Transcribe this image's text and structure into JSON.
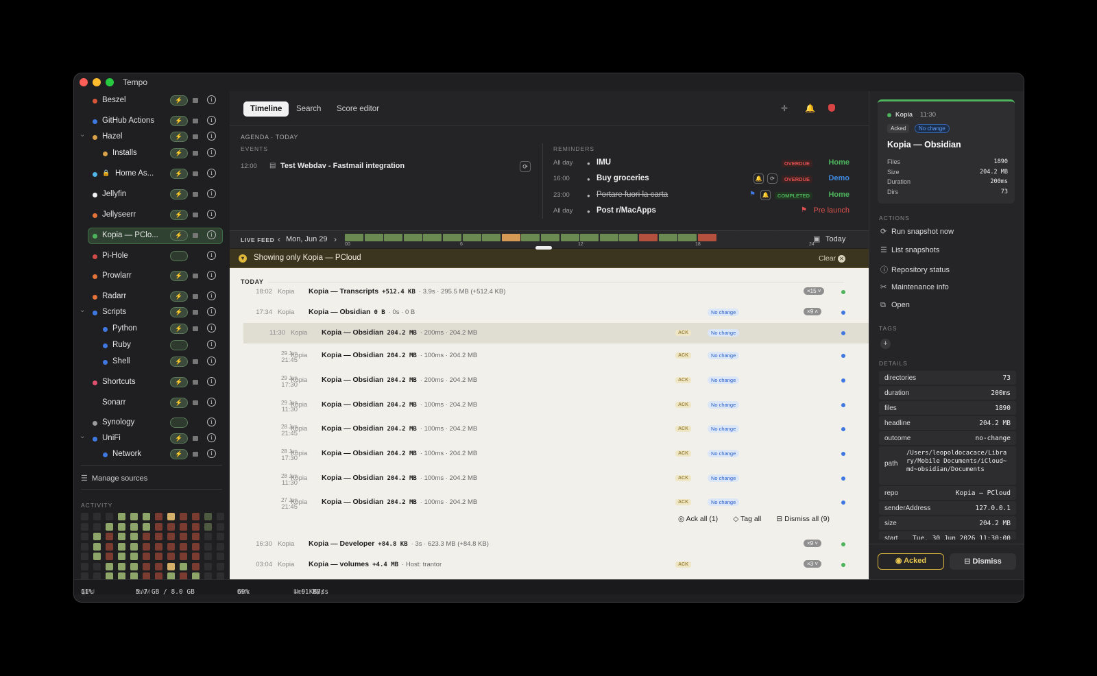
{
  "app": {
    "title": "Tempo"
  },
  "sidebar": {
    "sources": [
      {
        "name": "Beszel",
        "color": "#d5563b"
      },
      {
        "name": "GitHub Actions",
        "color": "#3f78e0"
      },
      {
        "name": "Hazel",
        "color": "#d9a14a"
      },
      {
        "name": "Installs",
        "color": "#d9a14a"
      },
      {
        "name": "Home As...",
        "color": "#4fb4e6"
      },
      {
        "name": "Jellyfin",
        "color": "#f2f2f2"
      },
      {
        "name": "Jellyseerr",
        "color": "#e4733a"
      },
      {
        "name": "Kopia — PClo...",
        "color": "#4db35c"
      },
      {
        "name": "Pi-Hole",
        "color": "#d14a4a"
      },
      {
        "name": "Prowlarr",
        "color": "#e4733a"
      },
      {
        "name": "Radarr",
        "color": "#e4733a"
      },
      {
        "name": "Scripts",
        "color": "#3f78e0"
      },
      {
        "name": "Python",
        "color": "#3f78e0"
      },
      {
        "name": "Ruby",
        "color": "#3f78e0"
      },
      {
        "name": "Shell",
        "color": "#3f78e0"
      },
      {
        "name": "Shortcuts",
        "color": "#e0506f"
      },
      {
        "name": "Sonarr",
        "color": "#3fbfd6"
      },
      {
        "name": "Synology",
        "color": "#9a9a9a"
      },
      {
        "name": "UniFi",
        "color": "#3f78e0"
      },
      {
        "name": "Network",
        "color": "#3f78e0"
      }
    ],
    "pill_glyph": "⚡",
    "manage_label": "Manage sources",
    "activity_label": "ACTIVITY"
  },
  "status": {
    "cpu_label": "CPU",
    "cpu": "11%",
    "ram_label": "RAM",
    "ram": "5.7 GB / 8.0 GB",
    "disk_label": "Disk",
    "disk": "69%",
    "net_label": "Net",
    "net_down": "↓ 9 KB/s",
    "net_up": "↑ 1 KB/s"
  },
  "toolbar": {
    "tabs": [
      "Timeline",
      "Search",
      "Score editor"
    ]
  },
  "agenda": {
    "heading": "AGENDA · TODAY",
    "events_label": "EVENTS",
    "reminders_label": "REMINDERS",
    "event": {
      "time": "12:00",
      "title": "Test Webdav - Fastmail integration"
    },
    "reminders": [
      {
        "time": "All day",
        "name": "IMU",
        "badge": "OVERDUE",
        "tag": "Home"
      },
      {
        "time": "16:00",
        "name": "Buy groceries",
        "badge": "OVERDUE",
        "tag": "Demo"
      },
      {
        "time": "23:00",
        "name": "Portare fuori la carta",
        "badge": "COMPLETED",
        "tag": "Home"
      },
      {
        "time": "All day",
        "name": "Post r/MacApps",
        "badge": "",
        "tag": "Pre launch"
      }
    ]
  },
  "livefeed": {
    "label": "LIVE FEED",
    "date": "Mon, Jun 29",
    "today": "Today",
    "ticks": [
      "00",
      "6",
      "12",
      "18",
      "24"
    ]
  },
  "filter": {
    "text": "Showing only Kopia — PCloud",
    "clear": "Clear"
  },
  "feed": {
    "section": "TODAY",
    "rows": [
      {
        "time": "18:02",
        "source": "Kopia",
        "title": "Kopia — Transcripts",
        "size": "+512.4 KB",
        "detail": "· 3.9s · 295.5 MB (+512.4 KB)",
        "count": "×15"
      },
      {
        "time": "17:34",
        "source": "Kopia",
        "title": "Kopia — Obsidian",
        "size": "0 B",
        "detail": "· 0s · 0 B",
        "nochange": "No change",
        "count": "×9"
      }
    ],
    "subrows": [
      {
        "date": "",
        "time": "11:30",
        "source": "Kopia",
        "title": "Kopia — Obsidian",
        "size": "204.2 MB",
        "detail": "· 200ms · 204.2 MB",
        "ack": "ACK",
        "nochange": "No change"
      },
      {
        "date": "29 Jun",
        "time": "21:45",
        "source": "Kopia",
        "title": "Kopia — Obsidian",
        "size": "204.2 MB",
        "detail": "· 100ms · 204.2 MB",
        "ack": "ACK",
        "nochange": "No change"
      },
      {
        "date": "29 Jun",
        "time": "17:30",
        "source": "Kopia",
        "title": "Kopia — Obsidian",
        "size": "204.2 MB",
        "detail": "· 200ms · 204.2 MB",
        "ack": "ACK",
        "nochange": "No change"
      },
      {
        "date": "29 Jun",
        "time": "11:30",
        "source": "Kopia",
        "title": "Kopia — Obsidian",
        "size": "204.2 MB",
        "detail": "· 100ms · 204.2 MB",
        "ack": "ACK",
        "nochange": "No change"
      },
      {
        "date": "28 Jun",
        "time": "21:45",
        "source": "Kopia",
        "title": "Kopia — Obsidian",
        "size": "204.2 MB",
        "detail": "· 100ms · 204.2 MB",
        "ack": "ACK",
        "nochange": "No change"
      },
      {
        "date": "28 Jun",
        "time": "17:30",
        "source": "Kopia",
        "title": "Kopia — Obsidian",
        "size": "204.2 MB",
        "detail": "· 100ms · 204.2 MB",
        "ack": "ACK",
        "nochange": "No change"
      },
      {
        "date": "28 Jun",
        "time": "11:30",
        "source": "Kopia",
        "title": "Kopia — Obsidian",
        "size": "204.2 MB",
        "detail": "· 100ms · 204.2 MB",
        "ack": "ACK",
        "nochange": "No change"
      },
      {
        "date": "27 Jun",
        "time": "21:45",
        "source": "Kopia",
        "title": "Kopia — Obsidian",
        "size": "204.2 MB",
        "detail": "· 100ms · 204.2 MB",
        "ack": "ACK",
        "nochange": "No change"
      }
    ],
    "group_actions": {
      "ack_all": "Ack all (1)",
      "tag_all": "Tag all",
      "dismiss_all": "Dismiss all (9)"
    },
    "tail_rows": [
      {
        "time": "16:30",
        "source": "Kopia",
        "title": "Kopia — Developer",
        "size": "+84.8 KB",
        "detail": "· 3s · 623.3 MB (+84.8 KB)",
        "count": "×9"
      },
      {
        "time": "03:04",
        "source": "Kopia",
        "title": "Kopia — volumes",
        "size": "+4.4 MB",
        "detail": "· Host: trantor",
        "ack": "ACK",
        "count": "×3"
      }
    ]
  },
  "inspector": {
    "source": "Kopia",
    "time": "11:30",
    "acked": "Acked",
    "nochange": "No change",
    "title": "Kopia — Obsidian",
    "stats": [
      {
        "k": "Files",
        "v": "1890"
      },
      {
        "k": "Size",
        "v": "204.2 MB"
      },
      {
        "k": "Duration",
        "v": "200ms"
      },
      {
        "k": "Dirs",
        "v": "73"
      }
    ],
    "actions_label": "ACTIONS",
    "actions": [
      "Run snapshot now",
      "List snapshots",
      "Repository status",
      "Maintenance info",
      "Open"
    ],
    "tags_label": "TAGS",
    "details_label": "DETAILS",
    "details": [
      {
        "k": "directories",
        "v": "73"
      },
      {
        "k": "duration",
        "v": "200ms"
      },
      {
        "k": "files",
        "v": "1890"
      },
      {
        "k": "headline",
        "v": "204.2 MB"
      },
      {
        "k": "outcome",
        "v": "no-change"
      },
      {
        "k": "path",
        "v": "/Users/leopoldocacace/Library/Mobile Documents/iCloud~md~obsidian/Documents"
      },
      {
        "k": "repo",
        "v": "Kopia — PCloud"
      },
      {
        "k": "senderAddress",
        "v": "127.0.0.1"
      },
      {
        "k": "size",
        "v": "204.2 MB"
      },
      {
        "k": "start",
        "v": "Tue, 30 Jun 2026 11:30:00"
      }
    ],
    "btn_acked": "Acked",
    "btn_dismiss": "Dismiss"
  },
  "colors": {
    "green": "#4db35c",
    "blue": "#3f78e0",
    "accent": "#e8c650",
    "overdue": "#e05050",
    "completed": "#4db35c"
  }
}
